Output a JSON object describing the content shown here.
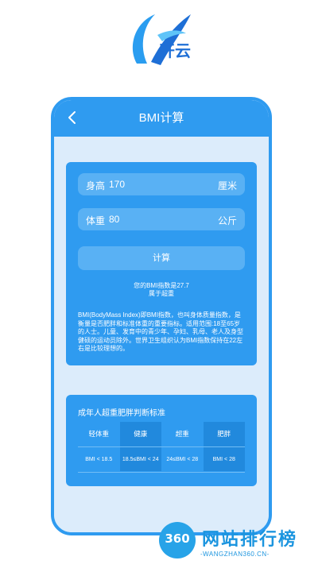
{
  "logo": {
    "letter": "K",
    "text": "开云"
  },
  "header": {
    "title": "BMI计算"
  },
  "form": {
    "height": {
      "label": "身高",
      "value": "170",
      "unit": "厘米"
    },
    "weight": {
      "label": "体重",
      "value": "80",
      "unit": "公斤"
    },
    "calc_label": "计算"
  },
  "result": {
    "line1": "您的BMI指数是27.7",
    "line2": "属于超重"
  },
  "description": "BMI(BodyMass Index)即BMI指数，也叫身体质量指数，是衡量是否肥胖和标准体重的重要指标。适用范围:18至65岁的人士。儿童、发育中的青少年、孕妇、乳母、老人及身型健硕的运动员除外。世界卫生组织认为BMI指数保持在22左右是比较理想的。",
  "standard": {
    "title": "成年人超重肥胖判断标准",
    "headers": [
      "轻体重",
      "健康",
      "超重",
      "肥胖"
    ],
    "ranges": [
      "BMI < 18.5",
      "18.5≤BMI < 24",
      "24≤BMI < 28",
      "BMI < 28"
    ]
  },
  "watermark": {
    "badge": "360",
    "name": "网站排行榜",
    "url": "-WANGZHAN360.CN-"
  },
  "colors": {
    "primary": "#2f9bf0",
    "field": "#59b1f4",
    "background": "#dcecfb"
  }
}
